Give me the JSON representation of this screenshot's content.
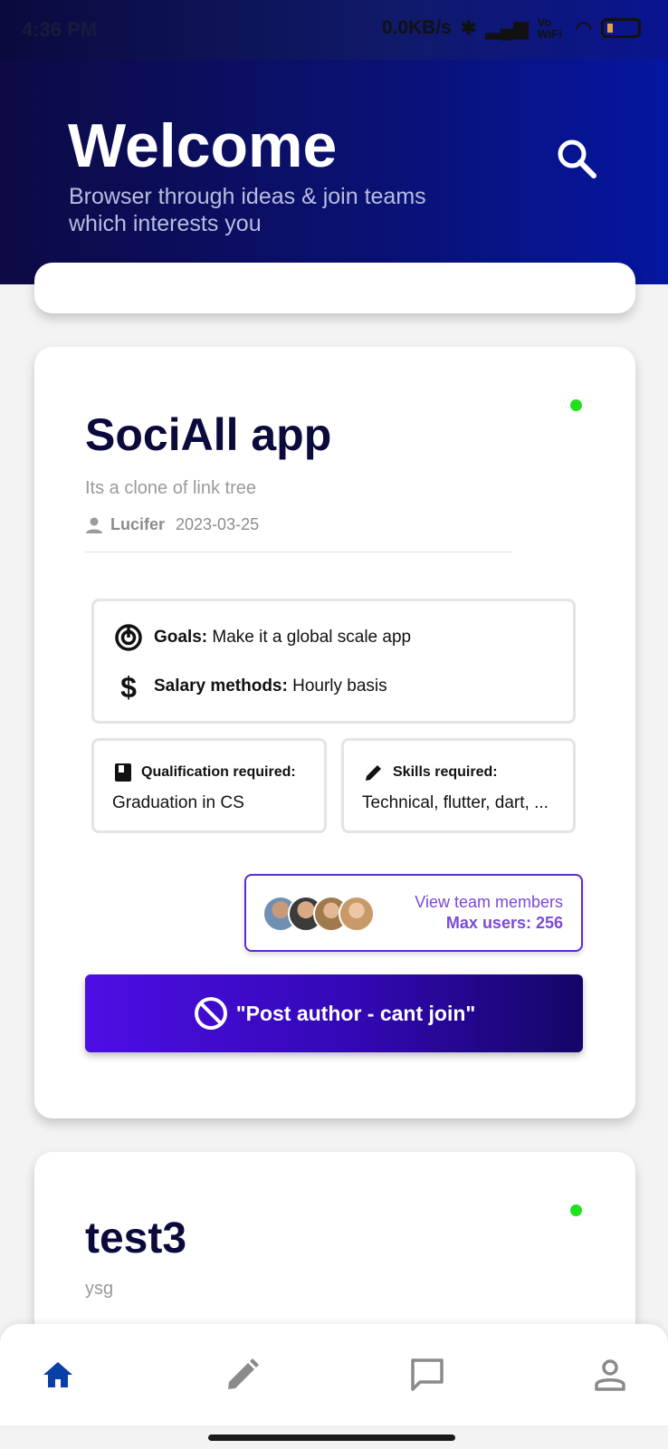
{
  "status_bar": {
    "time": "4:36 PM",
    "network_speed": "0.0KB/s",
    "volte": "Vo WiFi",
    "battery": "5"
  },
  "header": {
    "title": "Welcome",
    "subtitle": "Browser through ideas & join teams which interests you"
  },
  "posts": [
    {
      "title": "SociAll app",
      "description": "Its a clone of link tree",
      "author": "Lucifer",
      "date": "2023-03-25",
      "goals_label": "Goals:",
      "goals_value": "Make it a global scale app",
      "salary_label": "Salary methods:",
      "salary_value": "Hourly basis",
      "qualification_label": "Qualification required:",
      "qualification_value": "Graduation in CS",
      "skills_label": "Skills required:",
      "skills_value": "Technical, flutter, dart, ...",
      "view_team_label": "View team members",
      "max_users_label": "Max users: 256",
      "join_button_label": "\"Post author - cant join\"",
      "online": true
    },
    {
      "title": "test3",
      "description": "ysg",
      "online": true
    }
  ],
  "bottom_nav": {
    "items": [
      "home-icon",
      "edit-icon",
      "chat-icon",
      "profile-icon"
    ],
    "active": "home-icon"
  },
  "colors": {
    "header_bg": "#0a1172",
    "accent": "#4d0ee4",
    "online": "#22e01e",
    "team_text": "#7b4ad8"
  }
}
